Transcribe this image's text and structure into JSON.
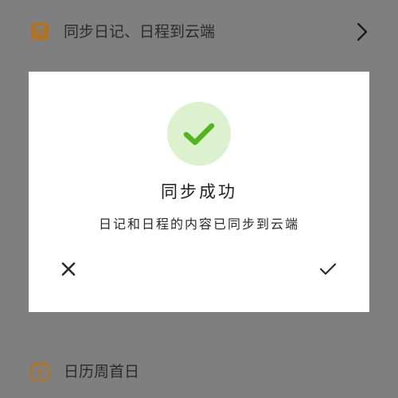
{
  "settings": {
    "sync_row": {
      "label": "同步日记、日程到云端",
      "icon": "cloud-save-icon",
      "chevron_icon": "chevron-right-icon"
    },
    "week_start_row": {
      "label": "日历周首日",
      "icon": "calendar-icon",
      "icon_number": "7"
    }
  },
  "dialog": {
    "status_icon": "checkmark-icon",
    "title": "同步成功",
    "message": "日记和日程的内容已同步到云端",
    "cancel_icon": "close-icon",
    "confirm_icon": "check-icon"
  },
  "colors": {
    "overlay_background": "#7f7f7f",
    "dialog_background": "#ffffff",
    "success_green": "#52b51f",
    "success_circle": "#dcf1cd",
    "icon_orange": "#b07322"
  }
}
